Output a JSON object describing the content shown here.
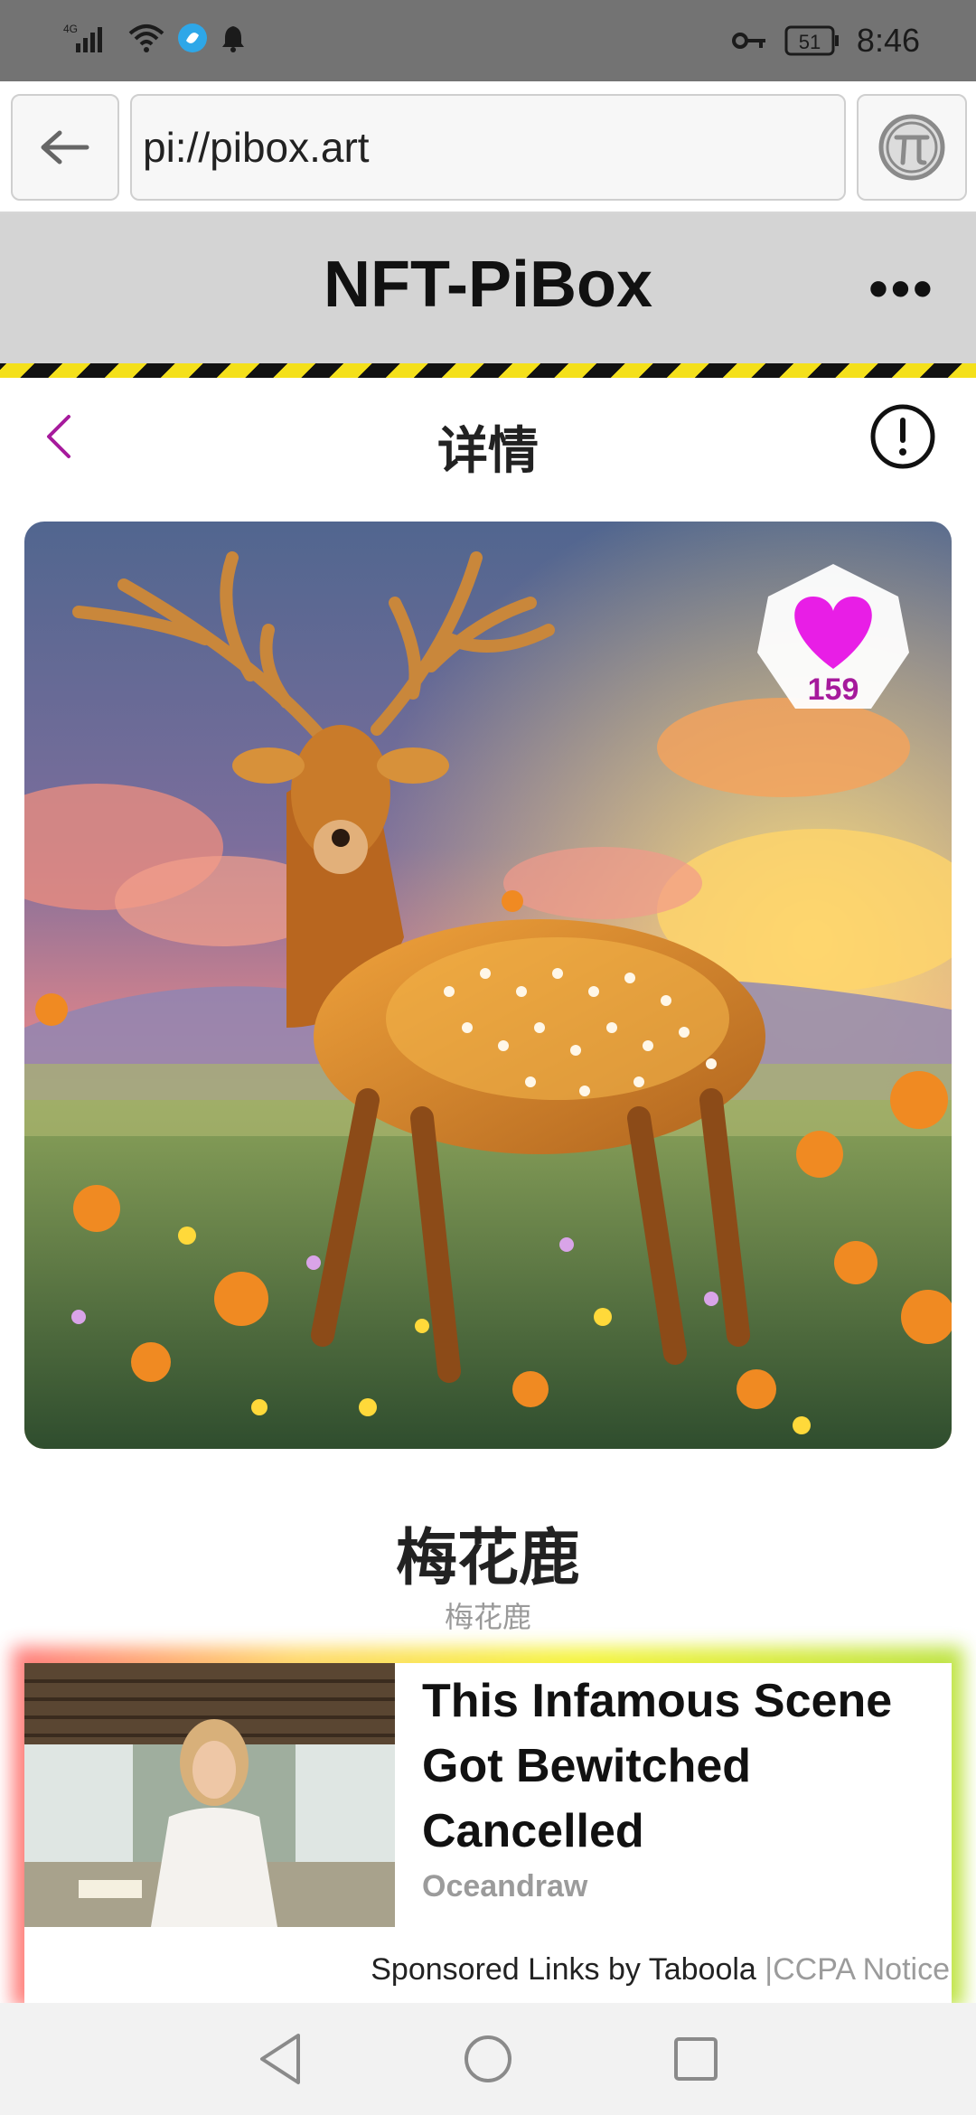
{
  "status_bar": {
    "network": "4G",
    "battery": "51",
    "time": "8:46",
    "icons": [
      "signal-icon",
      "wifi-icon",
      "app-notification-icon",
      "bell-icon",
      "key-icon",
      "battery-icon"
    ]
  },
  "browser": {
    "url": "pi://pibox.art",
    "back_icon": "arrow-left-icon",
    "pi_icon": "pi-logo-icon"
  },
  "app": {
    "title": "NFT-PiBox",
    "more_label": "•••"
  },
  "detail": {
    "title": "详情",
    "likes": "159",
    "name": "梅花鹿",
    "subtitle": "梅花鹿"
  },
  "ad": {
    "headline": "This Infamous Scene Got Bewitched Cancelled",
    "source": "Oceandraw",
    "sponsored": "Sponsored Links by Taboola",
    "separator": "|",
    "ccpa": "CCPA Notice"
  },
  "colors": {
    "accent_purple": "#a61a9c",
    "heart_magenta": "#e81ee6",
    "header_gray": "#d4d4d4",
    "hazard_yellow": "#f4e01b"
  }
}
